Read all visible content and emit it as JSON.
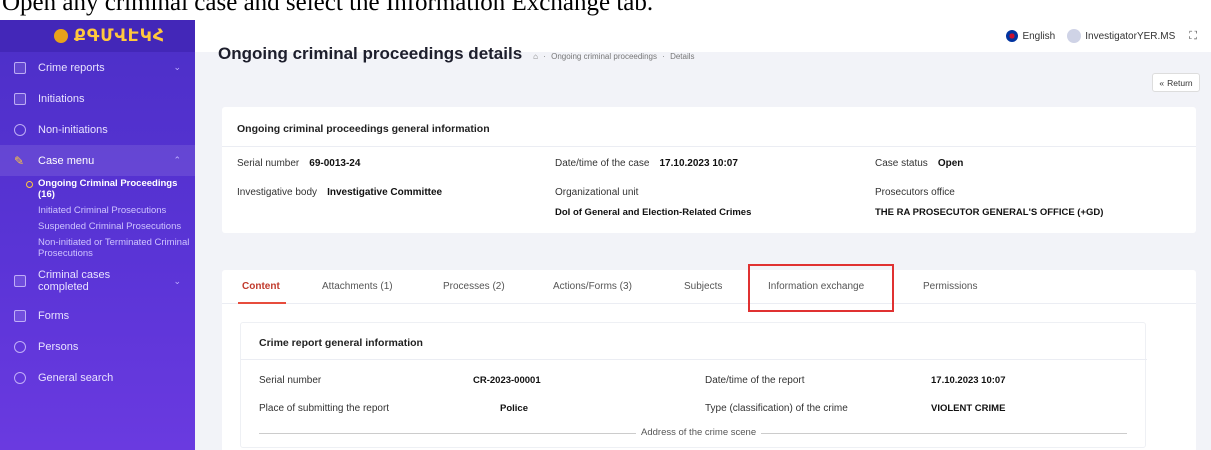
{
  "caption": "Open any criminal case and select the Information Exchange tab.",
  "sidebar": {
    "logo": "ՔԳՄՎԷԿՀ",
    "items": [
      {
        "label": "Crime reports",
        "chevron": "⌄"
      },
      {
        "label": "Initiations"
      },
      {
        "label": "Non-initiations"
      },
      {
        "label": "Case menu",
        "chevron": "⌃"
      },
      {
        "label": "Criminal cases completed",
        "chevron": "⌄"
      },
      {
        "label": "Forms"
      },
      {
        "label": "Persons"
      },
      {
        "label": "General search"
      }
    ],
    "sub_items": [
      "Ongoing Criminal Proceedings (16)",
      "Initiated Criminal Prosecutions",
      "Suspended Criminal Prosecutions",
      "Non-initiated or Terminated Criminal Prosecutions"
    ]
  },
  "topbar": {
    "language": "English",
    "user": "InvestigatorYER.MS"
  },
  "page": {
    "title": "Ongoing criminal proceedings details",
    "breadcrumb": [
      "Ongoing criminal proceedings",
      "Details"
    ],
    "return_label": "Return"
  },
  "general_info": {
    "title": "Ongoing criminal proceedings general information",
    "serial_label": "Serial number",
    "serial_value": "69-0013-24",
    "datetime_label": "Date/time of the case",
    "datetime_value": "17.10.2023 10:07",
    "status_label": "Case status",
    "status_value": "Open",
    "body_label": "Investigative body",
    "body_value": "Investigative Committee",
    "unit_label": "Organizational unit",
    "unit_value": "DoI of General and Election-Related Crimes",
    "prosecutor_label": "Prosecutors office",
    "prosecutor_value": "THE RA PROSECUTOR GENERAL'S OFFICE (+GD)"
  },
  "tabs": [
    "Content",
    "Attachments (1)",
    "Processes (2)",
    "Actions/Forms (3)",
    "Subjects",
    "Information exchange",
    "Permissions"
  ],
  "report": {
    "title": "Crime report general information",
    "serial_label": "Serial number",
    "serial_value": "CR-2023-00001",
    "datetime_label": "Date/time of the report",
    "datetime_value": "17.10.2023 10:07",
    "place_label": "Place of submitting the report",
    "place_value": "Police",
    "type_label": "Type (classification) of the crime",
    "type_value": "VIOLENT CRIME",
    "address_label": "Address of the crime scene"
  },
  "colors": {
    "sidebar": "#5a34d6",
    "accent": "#e74c3c",
    "highlight": "#e03131",
    "logo": "#ffc83d"
  }
}
